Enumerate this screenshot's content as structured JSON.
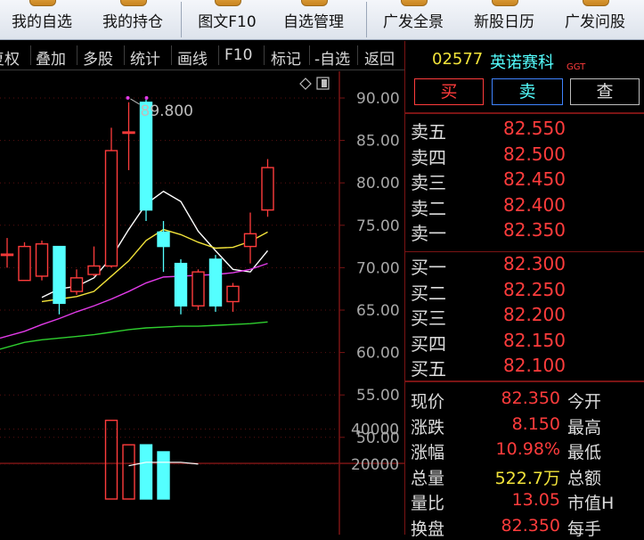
{
  "toolbar": {
    "items": [
      {
        "label": "我的自选",
        "icon": "star-folder-icon"
      },
      {
        "label": "我的持仓",
        "icon": "briefcase-icon"
      },
      {
        "label": "图文F10",
        "icon": "document-icon"
      },
      {
        "label": "自选管理",
        "icon": "list-icon"
      },
      {
        "label": "广发全景",
        "icon": "panorama-icon"
      },
      {
        "label": "新股日历",
        "icon": "calendar-icon"
      },
      {
        "label": "广发问股",
        "icon": "chat-icon"
      }
    ]
  },
  "chart_toolbar": {
    "items": [
      "复权",
      "叠加",
      "多股",
      "统计",
      "画线",
      "F10",
      "标记",
      "-自选",
      "返回"
    ]
  },
  "chart_data": {
    "type": "candlestick",
    "price_axis": {
      "ticks": [
        "90.00",
        "85.00",
        "80.00",
        "75.00",
        "70.00",
        "65.00",
        "60.00",
        "55.00",
        "50.00"
      ],
      "range": [
        46,
        92
      ]
    },
    "volume_axis": {
      "ticks": [
        "40000",
        "20000"
      ],
      "range": [
        0,
        46000
      ]
    },
    "high_label": "89.800",
    "candles": [
      {
        "o": 71.6,
        "h": 73.5,
        "l": 70.0,
        "c": 71.6
      },
      {
        "o": 68.5,
        "h": 73.0,
        "l": 68.5,
        "c": 72.5
      },
      {
        "o": 69.0,
        "h": 73.2,
        "l": 68.5,
        "c": 72.8
      },
      {
        "o": 72.5,
        "h": 72.5,
        "l": 64.5,
        "c": 65.8
      },
      {
        "o": 67.2,
        "h": 69.8,
        "l": 66.8,
        "c": 68.8
      },
      {
        "o": 69.2,
        "h": 72.5,
        "l": 69.0,
        "c": 70.2
      },
      {
        "o": 70.2,
        "h": 86.5,
        "l": 70.0,
        "c": 83.8
      },
      {
        "o": 86.0,
        "h": 89.5,
        "l": 81.5,
        "c": 86.0
      },
      {
        "o": 89.5,
        "h": 89.8,
        "l": 75.5,
        "c": 76.8
      },
      {
        "o": 74.2,
        "h": 75.5,
        "l": 69.5,
        "c": 72.5
      },
      {
        "o": 70.5,
        "h": 71.0,
        "l": 64.5,
        "c": 65.5
      },
      {
        "o": 65.5,
        "h": 69.8,
        "l": 65.0,
        "c": 69.5
      },
      {
        "o": 71.0,
        "h": 71.5,
        "l": 64.8,
        "c": 65.5
      },
      {
        "o": 66.0,
        "h": 68.2,
        "l": 64.8,
        "c": 67.8
      },
      {
        "o": 72.5,
        "h": 76.5,
        "l": 70.5,
        "c": 74.0
      },
      {
        "o": 76.8,
        "h": 82.8,
        "l": 76.0,
        "c": 81.8
      }
    ],
    "ma": [
      {
        "color": "#ffffff",
        "values": [
          null,
          null,
          66.5,
          67.5,
          67.8,
          68.8,
          71.2,
          74.5,
          77.5,
          79.0,
          77.8,
          74.3,
          72.0,
          69.8,
          69.5,
          72.0
        ]
      },
      {
        "color": "#f2e33a",
        "values": [
          null,
          null,
          66.0,
          66.3,
          66.6,
          67.2,
          69.0,
          70.8,
          73.2,
          74.5,
          73.9,
          73.0,
          72.3,
          72.4,
          73.1,
          74.2
        ]
      },
      {
        "color": "#e23be8",
        "values": [
          null,
          62.5,
          63.3,
          64.0,
          64.8,
          65.5,
          66.3,
          67.2,
          68.2,
          68.9,
          69.0,
          69.1,
          69.2,
          69.4,
          69.8,
          70.5
        ]
      },
      {
        "color": "#2fcf2f",
        "values": [
          null,
          61.2,
          61.5,
          61.7,
          61.9,
          62.1,
          62.4,
          62.7,
          62.9,
          63.0,
          63.1,
          63.1,
          63.2,
          63.3,
          63.4,
          63.6
        ]
      }
    ],
    "volume": [
      0,
      0,
      0,
      0,
      0,
      0,
      45000,
      31000,
      31000,
      27000,
      0,
      0,
      0,
      0,
      0,
      0
    ],
    "volume_ma": [
      null,
      null,
      null,
      null,
      null,
      null,
      null,
      19000,
      21000,
      21000,
      21000,
      20000,
      0,
      0,
      0,
      0
    ],
    "colors": {
      "up": "#ff3c3c",
      "down": "#54ffff"
    }
  },
  "quote": {
    "code": "02577",
    "name": "英诺赛科",
    "tag": "GGT",
    "buttons": {
      "buy": "买",
      "sell": "卖",
      "query": "查"
    },
    "asks": [
      {
        "label": "卖五",
        "price": "82.550"
      },
      {
        "label": "卖四",
        "price": "82.500"
      },
      {
        "label": "卖三",
        "price": "82.450"
      },
      {
        "label": "卖二",
        "price": "82.400"
      },
      {
        "label": "卖一",
        "price": "82.350"
      }
    ],
    "bids": [
      {
        "label": "买一",
        "price": "82.300"
      },
      {
        "label": "买二",
        "price": "82.250"
      },
      {
        "label": "买三",
        "price": "82.200"
      },
      {
        "label": "买四",
        "price": "82.150"
      },
      {
        "label": "买五",
        "price": "82.100"
      }
    ],
    "stats": [
      {
        "label": "现价",
        "value": "82.350",
        "color": "#ff3c3c",
        "right": "今开"
      },
      {
        "label": "涨跌",
        "value": "8.150",
        "color": "#ff3c3c",
        "right": "最高"
      },
      {
        "label": "涨幅",
        "value": "10.98%",
        "color": "#ff3c3c",
        "right": "最低"
      },
      {
        "label": "总量",
        "value": "522.7万",
        "color": "#f2e33a",
        "right": "总额"
      },
      {
        "label": "量比",
        "value": "13.05",
        "color": "#ff3c3c",
        "right": "市值H"
      },
      {
        "label": "换盘",
        "value": "82.350",
        "color": "#ff3c3c",
        "right": "每手"
      }
    ],
    "colors": {
      "red": "#ff3c3c",
      "cyan": "#54ffff",
      "yellow": "#f2e33a"
    }
  }
}
